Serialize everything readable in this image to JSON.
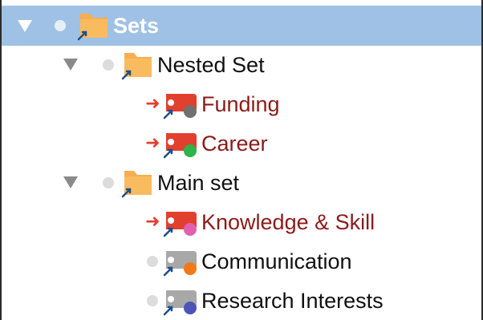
{
  "tree": {
    "root": {
      "label": "Sets",
      "expanded": true,
      "selected": true
    },
    "groups": [
      {
        "label": "Nested Set",
        "expanded": true,
        "items": [
          {
            "label": "Funding",
            "linked": true,
            "dot_color": "#707070",
            "label_color": "#8c1a1a"
          },
          {
            "label": "Career",
            "linked": true,
            "dot_color": "#2fb34a",
            "label_color": "#8c1a1a"
          }
        ]
      },
      {
        "label": "Main set",
        "expanded": true,
        "items": [
          {
            "label": "Knowledge & Skill",
            "linked": true,
            "dot_color": "#e060b0",
            "label_color": "#8c1a1a"
          },
          {
            "label": "Communication",
            "linked": false,
            "dot_color": "#f07a1a",
            "label_color": "#111111"
          },
          {
            "label": "Research Interests",
            "linked": false,
            "dot_color": "#4c55b5",
            "label_color": "#111111"
          }
        ]
      }
    ]
  },
  "colors": {
    "selection_bg": "#9fc1e5",
    "folder": "#f6ae4f",
    "tag_active": "#e2402e",
    "tag_inactive": "#a8a8a8",
    "alias_arrow": "#1f4e8c"
  },
  "icons": {
    "disclosure": "disclosure-triangle-icon",
    "folder": "folder-alias-icon",
    "code": "code-tag-icon",
    "link": "red-arrow-icon"
  }
}
